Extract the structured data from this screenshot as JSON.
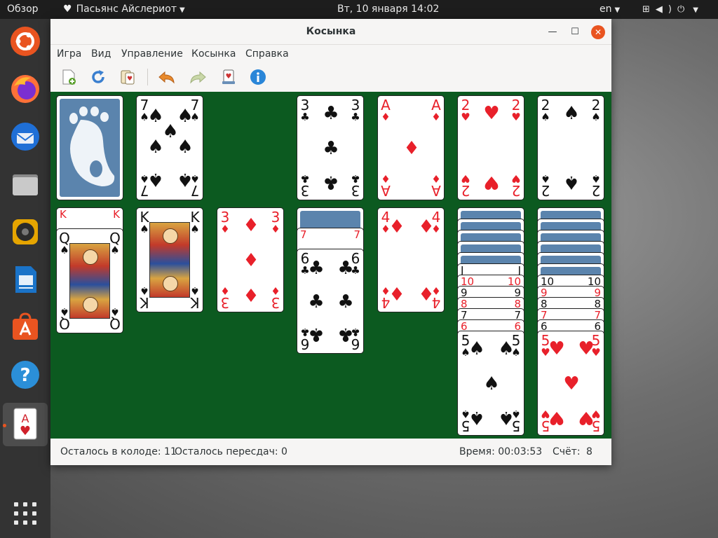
{
  "topbar": {
    "overview": "Обзор",
    "app_name": "Пасьянс Айслериот",
    "clock": "Вт, 10 января  14:02",
    "language": "en"
  },
  "dock": {
    "items": [
      "ubuntu",
      "firefox",
      "thunderbird",
      "files",
      "rhythmbox",
      "writer",
      "software",
      "help",
      "aisleriot",
      "app-grid"
    ]
  },
  "window": {
    "title": "Косынка",
    "menu": [
      "Игра",
      "Вид",
      "Управление",
      "Косынка",
      "Справка"
    ],
    "toolbar": [
      "new-game-icon",
      "restart-icon",
      "deal-icon",
      "undo-icon",
      "redo-icon",
      "hint-icon",
      "info-icon"
    ],
    "colors": {
      "felt": "#0c5a20",
      "card_back": "#5b84ad",
      "close": "#e95420"
    }
  },
  "game": {
    "stock": {
      "face_down": true
    },
    "waste": {
      "rank": "7",
      "suit": "♠"
    },
    "foundations": [
      {
        "rank": "3",
        "suit": "♣"
      },
      {
        "rank": "A",
        "suit": "♦"
      },
      {
        "rank": "2",
        "suit": "♥"
      },
      {
        "rank": "2",
        "suit": "♠"
      }
    ],
    "tableau": [
      {
        "fanned": [
          {
            "rank": "K",
            "suit": "♥"
          }
        ],
        "top": {
          "rank": "Q",
          "suit": "♠"
        }
      },
      {
        "fanned": [],
        "top": {
          "rank": "K",
          "suit": "♠"
        }
      },
      {
        "fanned": [],
        "top": {
          "rank": "3",
          "suit": "♦"
        }
      },
      {
        "fanned": [
          {
            "rank": "7",
            "suit": "♥"
          }
        ],
        "top": {
          "rank": "6",
          "suit": "♣"
        }
      },
      {
        "fanned": [],
        "top": {
          "rank": "4",
          "suit": "♦"
        }
      },
      {
        "fanned": [
          {
            "rank": "J",
            "suit": "♠"
          },
          {
            "rank": "10",
            "suit": "♥"
          },
          {
            "rank": "9",
            "suit": "♠"
          },
          {
            "rank": "8",
            "suit": "♥"
          },
          {
            "rank": "7",
            "suit": "♣"
          },
          {
            "rank": "6",
            "suit": "♥"
          }
        ],
        "top": {
          "rank": "5",
          "suit": "♠"
        }
      },
      {
        "fanned": [
          {
            "rank": "10",
            "suit": "♠"
          },
          {
            "rank": "9",
            "suit": "♥"
          },
          {
            "rank": "8",
            "suit": "♠"
          },
          {
            "rank": "7",
            "suit": "♥"
          },
          {
            "rank": "6",
            "suit": "♣"
          }
        ],
        "top": {
          "rank": "5",
          "suit": "♥"
        }
      }
    ]
  },
  "status": {
    "stock_left": "Осталось в колоде: 11",
    "redeals_left": "Осталось пересдач: 0",
    "time": "Время: 00:03:53",
    "score_label": "Счёт:",
    "score_value": "8"
  }
}
